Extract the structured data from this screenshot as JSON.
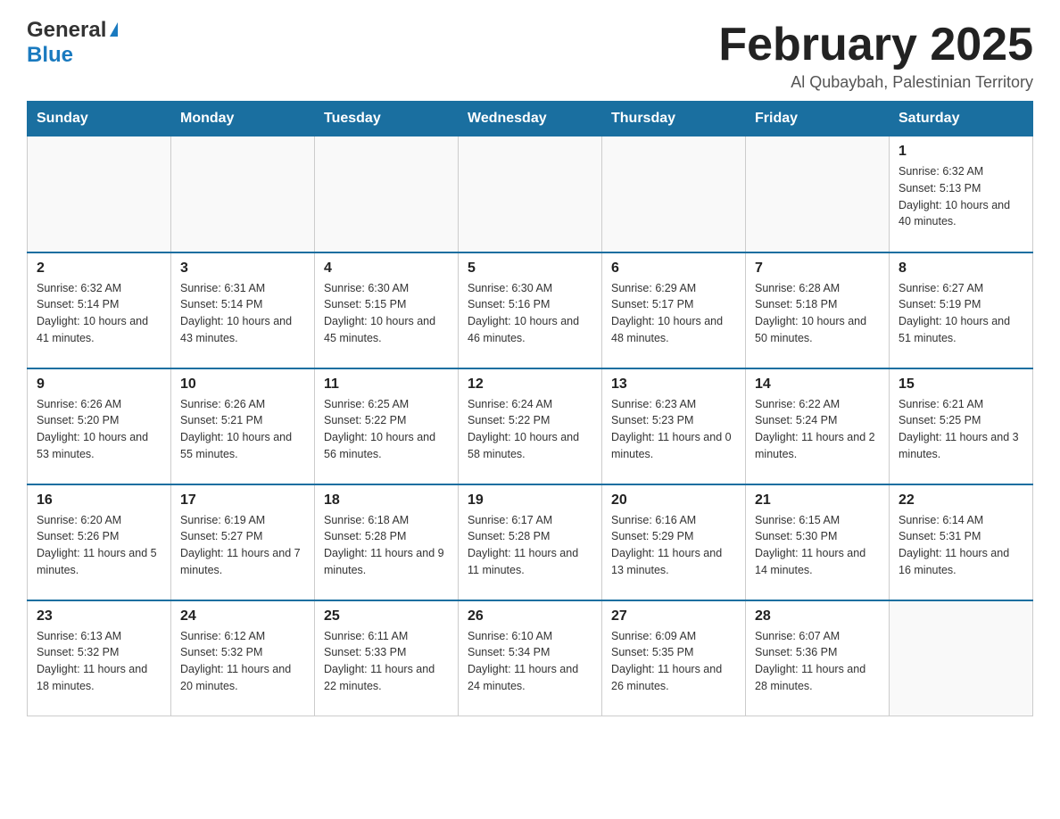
{
  "header": {
    "logo_general": "General",
    "logo_blue": "Blue",
    "month_title": "February 2025",
    "location": "Al Qubaybah, Palestinian Territory"
  },
  "days_of_week": [
    "Sunday",
    "Monday",
    "Tuesday",
    "Wednesday",
    "Thursday",
    "Friday",
    "Saturday"
  ],
  "weeks": [
    [
      {
        "day": "",
        "info": ""
      },
      {
        "day": "",
        "info": ""
      },
      {
        "day": "",
        "info": ""
      },
      {
        "day": "",
        "info": ""
      },
      {
        "day": "",
        "info": ""
      },
      {
        "day": "",
        "info": ""
      },
      {
        "day": "1",
        "info": "Sunrise: 6:32 AM\nSunset: 5:13 PM\nDaylight: 10 hours and 40 minutes."
      }
    ],
    [
      {
        "day": "2",
        "info": "Sunrise: 6:32 AM\nSunset: 5:14 PM\nDaylight: 10 hours and 41 minutes."
      },
      {
        "day": "3",
        "info": "Sunrise: 6:31 AM\nSunset: 5:14 PM\nDaylight: 10 hours and 43 minutes."
      },
      {
        "day": "4",
        "info": "Sunrise: 6:30 AM\nSunset: 5:15 PM\nDaylight: 10 hours and 45 minutes."
      },
      {
        "day": "5",
        "info": "Sunrise: 6:30 AM\nSunset: 5:16 PM\nDaylight: 10 hours and 46 minutes."
      },
      {
        "day": "6",
        "info": "Sunrise: 6:29 AM\nSunset: 5:17 PM\nDaylight: 10 hours and 48 minutes."
      },
      {
        "day": "7",
        "info": "Sunrise: 6:28 AM\nSunset: 5:18 PM\nDaylight: 10 hours and 50 minutes."
      },
      {
        "day": "8",
        "info": "Sunrise: 6:27 AM\nSunset: 5:19 PM\nDaylight: 10 hours and 51 minutes."
      }
    ],
    [
      {
        "day": "9",
        "info": "Sunrise: 6:26 AM\nSunset: 5:20 PM\nDaylight: 10 hours and 53 minutes."
      },
      {
        "day": "10",
        "info": "Sunrise: 6:26 AM\nSunset: 5:21 PM\nDaylight: 10 hours and 55 minutes."
      },
      {
        "day": "11",
        "info": "Sunrise: 6:25 AM\nSunset: 5:22 PM\nDaylight: 10 hours and 56 minutes."
      },
      {
        "day": "12",
        "info": "Sunrise: 6:24 AM\nSunset: 5:22 PM\nDaylight: 10 hours and 58 minutes."
      },
      {
        "day": "13",
        "info": "Sunrise: 6:23 AM\nSunset: 5:23 PM\nDaylight: 11 hours and 0 minutes."
      },
      {
        "day": "14",
        "info": "Sunrise: 6:22 AM\nSunset: 5:24 PM\nDaylight: 11 hours and 2 minutes."
      },
      {
        "day": "15",
        "info": "Sunrise: 6:21 AM\nSunset: 5:25 PM\nDaylight: 11 hours and 3 minutes."
      }
    ],
    [
      {
        "day": "16",
        "info": "Sunrise: 6:20 AM\nSunset: 5:26 PM\nDaylight: 11 hours and 5 minutes."
      },
      {
        "day": "17",
        "info": "Sunrise: 6:19 AM\nSunset: 5:27 PM\nDaylight: 11 hours and 7 minutes."
      },
      {
        "day": "18",
        "info": "Sunrise: 6:18 AM\nSunset: 5:28 PM\nDaylight: 11 hours and 9 minutes."
      },
      {
        "day": "19",
        "info": "Sunrise: 6:17 AM\nSunset: 5:28 PM\nDaylight: 11 hours and 11 minutes."
      },
      {
        "day": "20",
        "info": "Sunrise: 6:16 AM\nSunset: 5:29 PM\nDaylight: 11 hours and 13 minutes."
      },
      {
        "day": "21",
        "info": "Sunrise: 6:15 AM\nSunset: 5:30 PM\nDaylight: 11 hours and 14 minutes."
      },
      {
        "day": "22",
        "info": "Sunrise: 6:14 AM\nSunset: 5:31 PM\nDaylight: 11 hours and 16 minutes."
      }
    ],
    [
      {
        "day": "23",
        "info": "Sunrise: 6:13 AM\nSunset: 5:32 PM\nDaylight: 11 hours and 18 minutes."
      },
      {
        "day": "24",
        "info": "Sunrise: 6:12 AM\nSunset: 5:32 PM\nDaylight: 11 hours and 20 minutes."
      },
      {
        "day": "25",
        "info": "Sunrise: 6:11 AM\nSunset: 5:33 PM\nDaylight: 11 hours and 22 minutes."
      },
      {
        "day": "26",
        "info": "Sunrise: 6:10 AM\nSunset: 5:34 PM\nDaylight: 11 hours and 24 minutes."
      },
      {
        "day": "27",
        "info": "Sunrise: 6:09 AM\nSunset: 5:35 PM\nDaylight: 11 hours and 26 minutes."
      },
      {
        "day": "28",
        "info": "Sunrise: 6:07 AM\nSunset: 5:36 PM\nDaylight: 11 hours and 28 minutes."
      },
      {
        "day": "",
        "info": ""
      }
    ]
  ]
}
